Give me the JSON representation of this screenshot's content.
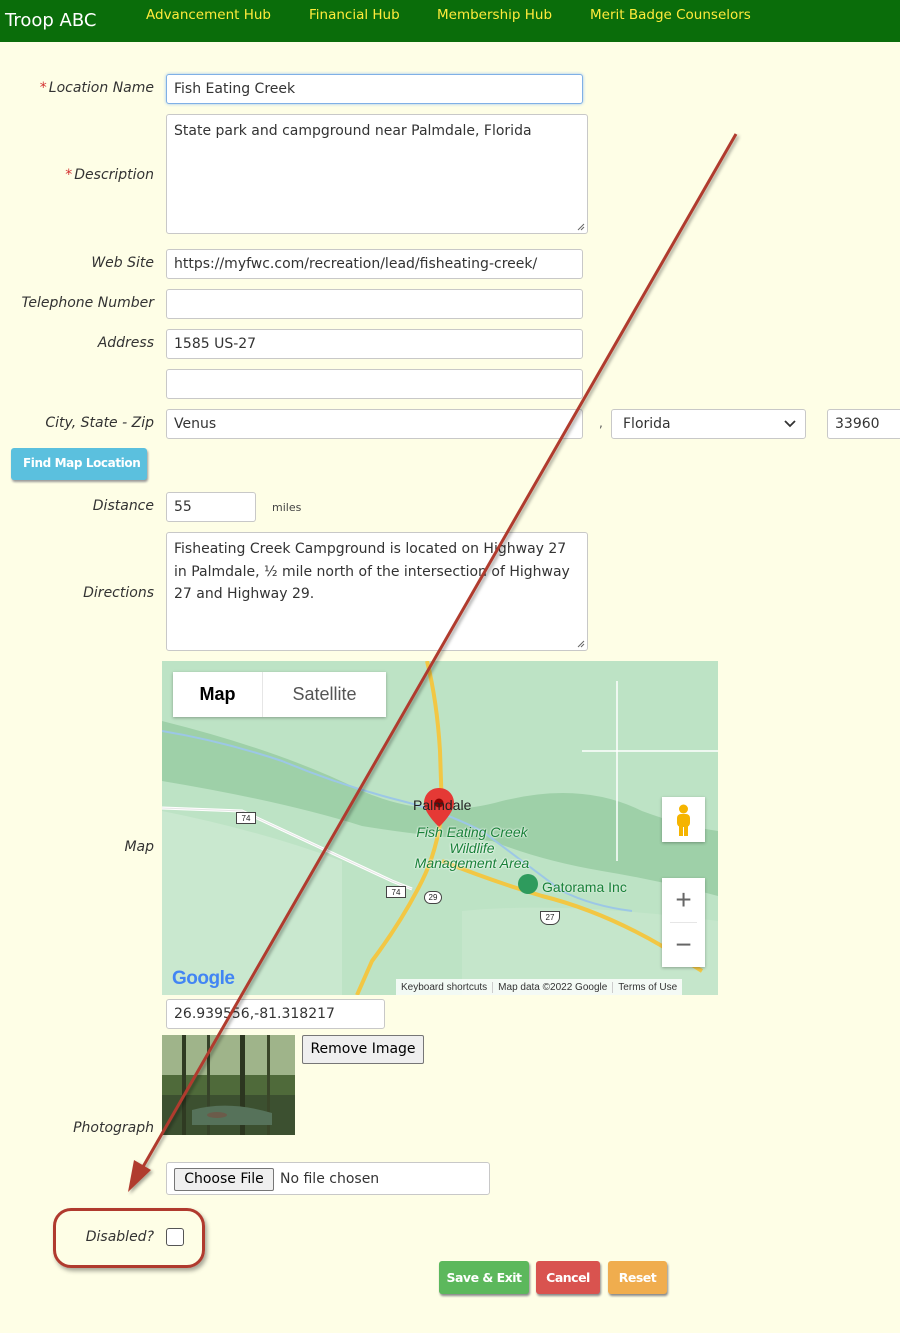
{
  "nav": {
    "brand": "Troop ABC",
    "links": [
      "Advancement Hub",
      "Financial Hub",
      "Membership Hub",
      "Merit Badge Counselors"
    ]
  },
  "form": {
    "location_name": {
      "label": "Location Name",
      "value": "Fish Eating Creek"
    },
    "description": {
      "label": "Description",
      "value": "State park and campground near Palmdale, Florida"
    },
    "website": {
      "label": "Web Site",
      "value": "https://myfwc.com/recreation/lead/fisheating-creek/"
    },
    "telephone": {
      "label": "Telephone Number",
      "value": ""
    },
    "address": {
      "label": "Address",
      "line1": "1585 US-27",
      "line2": ""
    },
    "city_state_zip": {
      "label": "City, State - Zip",
      "city": "Venus",
      "separator": ",",
      "state": "Florida",
      "zip": "33960"
    },
    "find_map_button": "Find Map Location",
    "distance": {
      "label": "Distance",
      "value": "55",
      "unit": "miles"
    },
    "directions": {
      "label": "Directions",
      "value": "Fisheating Creek Campground is located on Highway 27 in Palmdale, ½ mile north of the intersection of Highway 27 and Highway 29."
    },
    "map": {
      "label": "Map",
      "tab_map": "Map",
      "tab_satellite": "Satellite",
      "place_town": "Palmdale",
      "place_area": "Fish Eating Creek Wildlife Management Area",
      "place_poi": "Gatorama Inc",
      "route_74": "74",
      "route_29": "29",
      "route_27": "27",
      "zoom_in": "+",
      "zoom_out": "−",
      "google": "Google",
      "attribution": [
        "Keyboard shortcuts",
        "Map data ©2022 Google",
        "Terms of Use"
      ],
      "coordinates": "26.939556,-81.318217"
    },
    "photograph": {
      "label": "Photograph",
      "remove_button": "Remove Image",
      "choose_button": "Choose File",
      "file_status": "No file chosen"
    },
    "disabled": {
      "label": "Disabled?",
      "checked": false
    },
    "buttons": {
      "save": "Save & Exit",
      "cancel": "Cancel",
      "reset": "Reset"
    }
  },
  "colors": {
    "nav_bg": "#0a6d0a",
    "nav_link": "#ffeb3b",
    "page_bg": "#fefee6",
    "annotation": "#b03a2e",
    "save": "#5cb85c",
    "cancel": "#d9534f",
    "reset": "#f0ad4e",
    "find_map": "#5bc0de"
  }
}
